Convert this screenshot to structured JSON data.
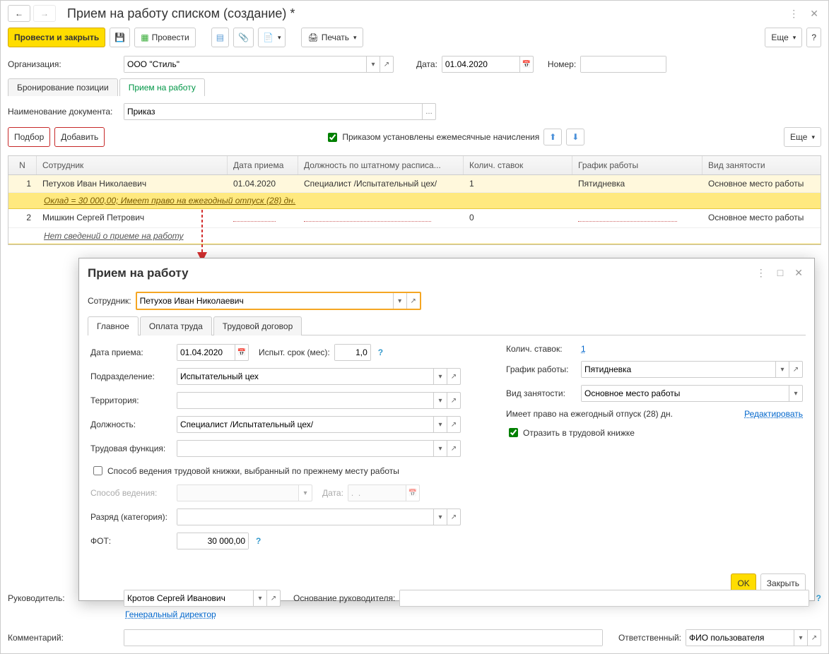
{
  "title": "Прием на работу списком (создание) *",
  "toolbar": {
    "post_close": "Провести и закрыть",
    "post": "Провести",
    "print": "Печать",
    "more": "Еще"
  },
  "header": {
    "org_label": "Организация:",
    "org_value": "ООО \"Стиль\"",
    "date_label": "Дата:",
    "date_value": "01.04.2020",
    "number_label": "Номер:",
    "number_value": ""
  },
  "main_tabs": {
    "t1": "Бронирование позиции",
    "t2": "Прием на работу"
  },
  "doc_name_label": "Наименование документа:",
  "doc_name_value": "Приказ",
  "actions": {
    "select": "Подбор",
    "add": "Добавить",
    "monthly_check": "Приказом установлены ежемесячные начисления",
    "more": "Еще"
  },
  "table": {
    "h_n": "N",
    "h_emp": "Сотрудник",
    "h_date": "Дата приема",
    "h_pos": "Должность по штатному расписа...",
    "h_rate": "Колич. ставок",
    "h_sched": "График работы",
    "h_type": "Вид занятости",
    "rows": [
      {
        "n": "1",
        "emp": "Петухов Иван Николаевич",
        "date": "01.04.2020",
        "pos": "Специалист /Испытательный цех/",
        "rate": "1",
        "sched": "Пятидневка",
        "type": "Основное место работы",
        "detail": "Оклад = 30 000,00; Имеет право на ежегодный отпуск (28) дн."
      },
      {
        "n": "2",
        "emp": "Мишкин Сергей Петрович",
        "date": "",
        "pos": "",
        "rate": "0",
        "sched": "",
        "type": "Основное место работы",
        "detail": "Нет сведений о приеме на работу"
      }
    ]
  },
  "modal": {
    "title": "Прием на работу",
    "emp_label": "Сотрудник:",
    "emp_value": "Петухов Иван Николаевич",
    "tabs": {
      "t1": "Главное",
      "t2": "Оплата труда",
      "t3": "Трудовой договор"
    },
    "left": {
      "date_label": "Дата приема:",
      "date_value": "01.04.2020",
      "trial_label": "Испыт. срок (мес):",
      "trial_value": "1,0",
      "dept_label": "Подразделение:",
      "dept_value": "Испытательный цех",
      "terr_label": "Территория:",
      "terr_value": "",
      "pos_label": "Должность:",
      "pos_value": "Специалист /Испытательный цех/",
      "func_label": "Трудовая функция:",
      "func_value": "",
      "workbook_check": "Способ ведения трудовой книжки, выбранный по прежнему месту работы",
      "method_label": "Способ ведения:",
      "method_date_label": "Дата:",
      "method_date_ph": ".  .",
      "rank_label": "Разряд (категория):",
      "rank_value": "",
      "fot_label": "ФОТ:",
      "fot_value": "30 000,00"
    },
    "right": {
      "rate_label": "Колич. ставок:",
      "rate_value": "1",
      "sched_label": "График работы:",
      "sched_value": "Пятидневка",
      "type_label": "Вид занятости:",
      "type_value": "Основное место работы",
      "vacation_text": "Имеет право на ежегодный отпуск (28) дн.",
      "edit_link": "Редактировать",
      "workbook_reflect": "Отразить в трудовой книжке"
    },
    "footer": {
      "ok": "OK",
      "close": "Закрыть"
    }
  },
  "footer": {
    "head_label": "Руководитель:",
    "head_value": "Кротов Сергей Иванович",
    "head_title": "Генеральный директор",
    "basis_label": "Основание руководителя:",
    "basis_value": "",
    "comment_label": "Комментарий:",
    "comment_value": "",
    "resp_label": "Ответственный:",
    "resp_value": "ФИО пользователя"
  }
}
